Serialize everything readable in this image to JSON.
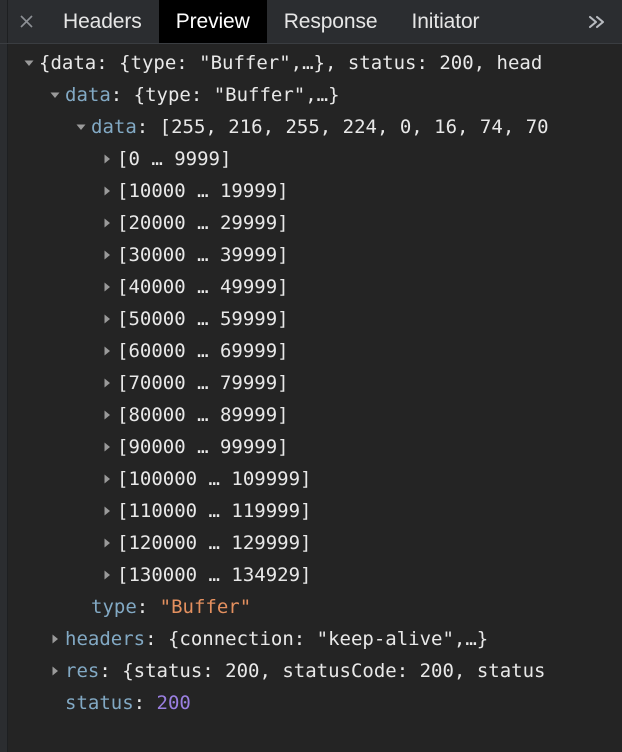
{
  "tabbar": {
    "close_icon": "close-icon",
    "overflow_icon": "chevron-double-right-icon",
    "tabs": [
      {
        "label": "Headers",
        "active": false
      },
      {
        "label": "Preview",
        "active": true
      },
      {
        "label": "Response",
        "active": false
      },
      {
        "label": "Initiator",
        "active": false
      }
    ]
  },
  "colors": {
    "tabbar_bg": "#2b2d30",
    "active_tab_bg": "#000000",
    "pane_bg": "#242424",
    "key": "#82a9c4",
    "string": "#e4905f",
    "number": "#9a7fe0",
    "plain": "#e8e8e8",
    "triangle": "#9a9a9a"
  },
  "tree": {
    "rows": [
      {
        "indent": 0,
        "toggle": "expanded",
        "segments": [
          {
            "t": "{data: {type: \"Buffer\",…}, status: 200, head",
            "c": "pl"
          }
        ]
      },
      {
        "indent": 1,
        "toggle": "expanded",
        "segments": [
          {
            "t": "data",
            "c": "k"
          },
          {
            "t": ": {type: \"Buffer\",…}",
            "c": "pl"
          }
        ]
      },
      {
        "indent": 2,
        "toggle": "expanded",
        "segments": [
          {
            "t": "data",
            "c": "k"
          },
          {
            "t": ": [255, 216, 255, 224, 0, 16, 74, 70",
            "c": "pl"
          }
        ]
      },
      {
        "indent": 3,
        "toggle": "collapsed",
        "segments": [
          {
            "t": "[0 … 9999]",
            "c": "pl"
          }
        ]
      },
      {
        "indent": 3,
        "toggle": "collapsed",
        "segments": [
          {
            "t": "[10000 … 19999]",
            "c": "pl"
          }
        ]
      },
      {
        "indent": 3,
        "toggle": "collapsed",
        "segments": [
          {
            "t": "[20000 … 29999]",
            "c": "pl"
          }
        ]
      },
      {
        "indent": 3,
        "toggle": "collapsed",
        "segments": [
          {
            "t": "[30000 … 39999]",
            "c": "pl"
          }
        ]
      },
      {
        "indent": 3,
        "toggle": "collapsed",
        "segments": [
          {
            "t": "[40000 … 49999]",
            "c": "pl"
          }
        ]
      },
      {
        "indent": 3,
        "toggle": "collapsed",
        "segments": [
          {
            "t": "[50000 … 59999]",
            "c": "pl"
          }
        ]
      },
      {
        "indent": 3,
        "toggle": "collapsed",
        "segments": [
          {
            "t": "[60000 … 69999]",
            "c": "pl"
          }
        ]
      },
      {
        "indent": 3,
        "toggle": "collapsed",
        "segments": [
          {
            "t": "[70000 … 79999]",
            "c": "pl"
          }
        ]
      },
      {
        "indent": 3,
        "toggle": "collapsed",
        "segments": [
          {
            "t": "[80000 … 89999]",
            "c": "pl"
          }
        ]
      },
      {
        "indent": 3,
        "toggle": "collapsed",
        "segments": [
          {
            "t": "[90000 … 99999]",
            "c": "pl"
          }
        ]
      },
      {
        "indent": 3,
        "toggle": "collapsed",
        "segments": [
          {
            "t": "[100000 … 109999]",
            "c": "pl"
          }
        ]
      },
      {
        "indent": 3,
        "toggle": "collapsed",
        "segments": [
          {
            "t": "[110000 … 119999]",
            "c": "pl"
          }
        ]
      },
      {
        "indent": 3,
        "toggle": "collapsed",
        "segments": [
          {
            "t": "[120000 … 129999]",
            "c": "pl"
          }
        ]
      },
      {
        "indent": 3,
        "toggle": "collapsed",
        "segments": [
          {
            "t": "[130000 … 134929]",
            "c": "pl"
          }
        ]
      },
      {
        "indent": 2,
        "toggle": "none",
        "segments": [
          {
            "t": "type",
            "c": "k"
          },
          {
            "t": ": ",
            "c": "pl"
          },
          {
            "t": "\"Buffer\"",
            "c": "str"
          }
        ]
      },
      {
        "indent": 1,
        "toggle": "collapsed",
        "segments": [
          {
            "t": "headers",
            "c": "k"
          },
          {
            "t": ": {connection: \"keep-alive\",…}",
            "c": "pl"
          }
        ]
      },
      {
        "indent": 1,
        "toggle": "collapsed",
        "segments": [
          {
            "t": "res",
            "c": "k"
          },
          {
            "t": ": {status: 200, statusCode: 200, status",
            "c": "pl"
          }
        ]
      },
      {
        "indent": 1,
        "toggle": "none",
        "segments": [
          {
            "t": "status",
            "c": "k"
          },
          {
            "t": ": ",
            "c": "pl"
          },
          {
            "t": "200",
            "c": "num"
          }
        ]
      }
    ]
  }
}
